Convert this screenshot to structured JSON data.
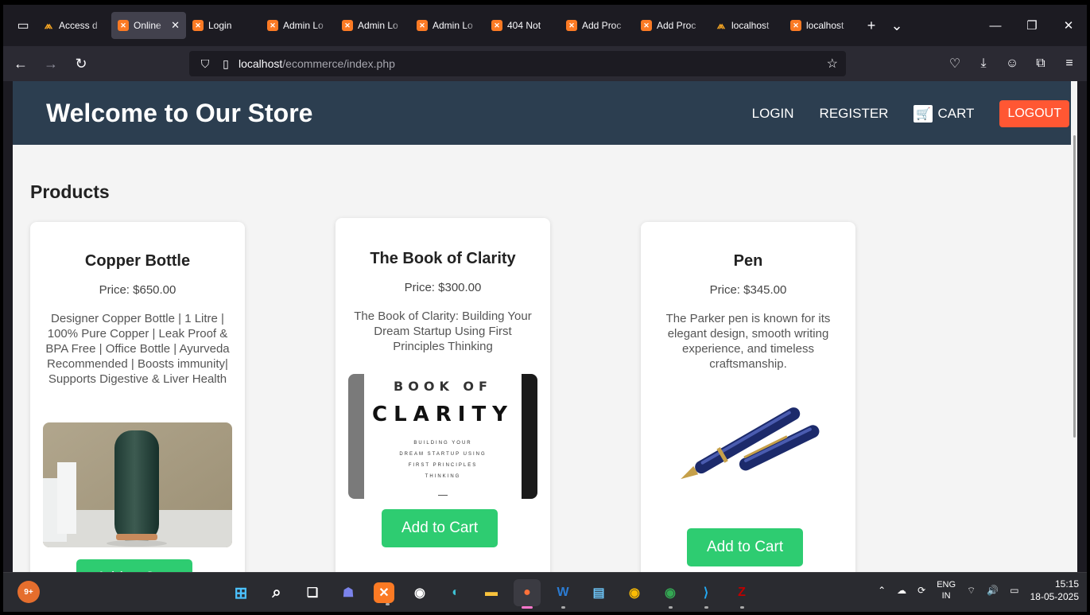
{
  "browser": {
    "tabs": [
      {
        "title": "Access d",
        "icon": "phpmyadmin-icon",
        "active": false
      },
      {
        "title": "Online",
        "icon": "xampp-icon",
        "active": true
      },
      {
        "title": "Login",
        "icon": "xampp-icon",
        "active": false
      },
      {
        "title": "Admin Lo",
        "icon": "xampp-icon",
        "active": false
      },
      {
        "title": "Admin Lo",
        "icon": "xampp-icon",
        "active": false
      },
      {
        "title": "Admin Lo",
        "icon": "xampp-icon",
        "active": false
      },
      {
        "title": "404 Not",
        "icon": "xampp-icon",
        "active": false
      },
      {
        "title": "Add Proc",
        "icon": "xampp-icon",
        "active": false
      },
      {
        "title": "Add Proc",
        "icon": "xampp-icon",
        "active": false
      },
      {
        "title": "localhost",
        "icon": "phpmyadmin-icon",
        "active": false
      },
      {
        "title": "localhost",
        "icon": "xampp-icon",
        "active": false
      }
    ],
    "url_host": "localhost",
    "url_path": "/ecommerce/index.php"
  },
  "site": {
    "title": "Welcome to Our Store",
    "nav": {
      "login": "LOGIN",
      "register": "REGISTER",
      "cart": "CART",
      "logout": "LOGOUT"
    },
    "section_title": "Products",
    "add_to_cart": "Add to Cart",
    "products": [
      {
        "name": "Copper Bottle",
        "price": "Price: $650.00",
        "description": "Designer Copper Bottle | 1 Litre | 100% Pure Copper | Leak Proof & BPA Free | Office Bottle | Ayurveda Recommended | Boosts immunity| Supports Digestive & Liver Health"
      },
      {
        "name": "The Book of Clarity",
        "price": "Price: $300.00",
        "description": "The Book of Clarity: Building Your Dream Startup Using First Principles Thinking",
        "cover": {
          "line1": "BOOK OF",
          "line2": "CLARITY",
          "sub1": "BUILDING YOUR",
          "sub2": "DREAM STARTUP USING",
          "sub3": "FIRST PRINCIPLES",
          "sub4": "THINKING"
        }
      },
      {
        "name": "Pen",
        "price": "Price: $345.00",
        "description": "The Parker pen is known for its elegant design, smooth writing experience, and timeless craftsmanship."
      }
    ]
  },
  "taskbar": {
    "weather_badge": "9+",
    "language": "ENG",
    "region": "IN",
    "time": "15:15",
    "date": "18-05-2025"
  },
  "colors": {
    "header_bg": "#2c3e50",
    "logout_bg": "#ff5733",
    "add_to_cart_bg": "#2ecc71"
  }
}
